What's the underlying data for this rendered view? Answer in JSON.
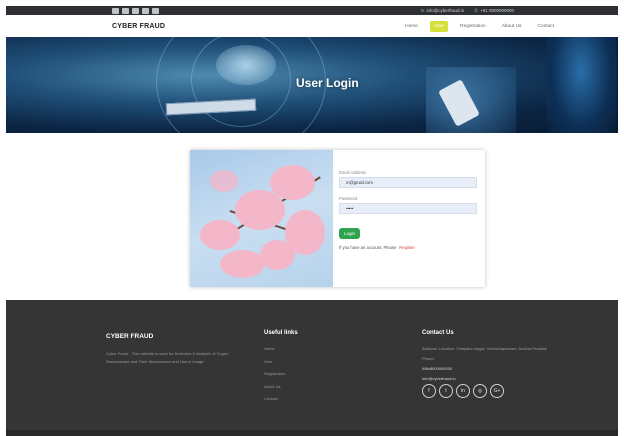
{
  "topbar": {
    "social_icons": [
      "facebook-icon",
      "twitter-icon",
      "linkedin-icon",
      "instagram-icon",
      "googleplus-icon"
    ],
    "email": "info@cyberfraud.in",
    "phone": "+91 0000000000"
  },
  "navbar": {
    "brand": "CYBER FRAUD",
    "items": [
      {
        "label": "Home",
        "active": false
      },
      {
        "label": "User",
        "active": true
      },
      {
        "label": "Registration",
        "active": false
      },
      {
        "label": "About Us",
        "active": false
      },
      {
        "label": "Contact",
        "active": false
      }
    ]
  },
  "hero": {
    "title": "User Login"
  },
  "login": {
    "email_label": "Email Address",
    "email_value": "m@gmail.com",
    "password_label": "Password",
    "password_value": "•••••",
    "button": "Login",
    "register_prompt": "If you have an account, Please",
    "register_link": "Register"
  },
  "footer": {
    "brand": "CYBER FRAUD",
    "description": "Cyber Fraud - This website is used for Detection & Analysis of Crypto Ransomware and Their Mechanisms and Use in Image.",
    "links_title": "Useful links",
    "links": [
      "Home",
      "User",
      "Registration",
      "About Us",
      "Contact"
    ],
    "contact_title": "Contact Us",
    "address": "Address: Location: Vinayaka Nagar, Vishakhapatnam, Andhra Pradesh",
    "phone_label": "Phone:",
    "phone": "+91 0000000000",
    "email_label": "Email:",
    "email": "info@cyberfraud.in",
    "social_icons": [
      {
        "name": "facebook-icon",
        "glyph": "f"
      },
      {
        "name": "twitter-icon",
        "glyph": "t"
      },
      {
        "name": "linkedin-icon",
        "glyph": "in"
      },
      {
        "name": "instagram-icon",
        "glyph": "◎"
      },
      {
        "name": "googleplus-icon",
        "glyph": "G+"
      }
    ]
  },
  "colors": {
    "topbar_bg": "#2e2f33",
    "nav_active": "#d6e03a",
    "login_button": "#2ea44f",
    "register_link": "#d64545",
    "footer_bg": "#353535"
  }
}
